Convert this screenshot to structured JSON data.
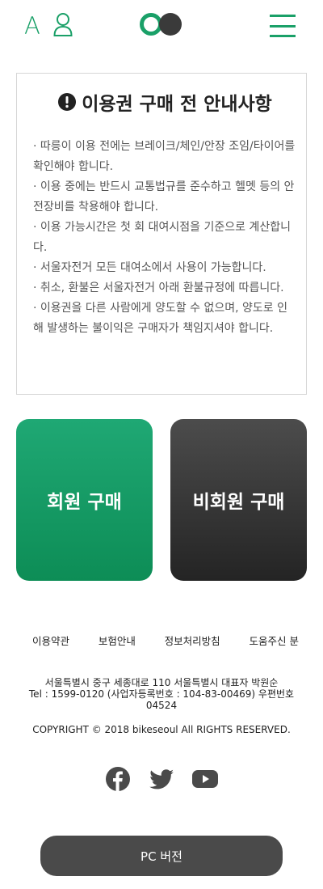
{
  "header": {
    "font_size_label": "A",
    "icons": [
      "user-icon",
      "logo",
      "hamburger-menu-icon"
    ]
  },
  "notice": {
    "title": "이용권 구매 전 안내사항",
    "items": [
      "· 따릉이 이용 전에는 브레이크/체인/안장 조임/타이어를 확인해야 합니다.",
      "· 이용 중에는 반드시 교통법규를 준수하고 헬멧 등의 안전장비를 착용해야 합니다.",
      "· 이용 가능시간은 첫 회 대여시점을 기준으로 계산합니다.",
      "· 서울자전거 모든 대여소에서 사용이 가능합니다.",
      "· 취소, 환불은 서울자전거 아래 환불규정에 따릅니다.",
      "· 이용권을 다른 사람에게 양도할 수 없으며, 양도로 인해 발생하는 불이익은 구매자가 책임지셔야 합니다."
    ]
  },
  "purchase": {
    "member_label": "회원 구매",
    "guest_label": "비회원 구매"
  },
  "footer": {
    "links": [
      "이용약관",
      "보험안내",
      "정보처리방침",
      "도움주신 분"
    ],
    "address": "서울특별시 중구 세종대로 110 서울특별시 대표자 박원순",
    "contact": "Tel : 1599-0120 (사업자등록번호 : 104-83-00469) 우편번호 04524",
    "copyright": "COPYRIGHT © 2018 bikeseoul All RIGHTS RESERVED.",
    "social": [
      "facebook-icon",
      "twitter-icon",
      "youtube-icon"
    ],
    "pc_version_label": "PC 버전"
  },
  "colors": {
    "brand_green": "#1aa068",
    "dark_button": "#4a4a4a"
  }
}
